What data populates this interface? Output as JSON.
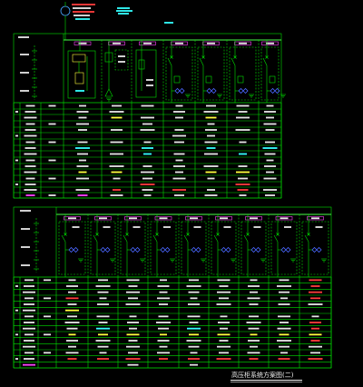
{
  "drawing": {
    "title": "高压柜系统方案图(二)"
  },
  "colors": {
    "background": "#000000",
    "frame": "#00e000",
    "busbar": "#49ff49",
    "label_box": "#ff40ff",
    "current_transformer": "#4a66ff",
    "symbol": "#4aa8ff",
    "text_white": "#e6e6e6",
    "text_yellow": "#ffff3c",
    "text_cyan": "#33ffff",
    "text_red": "#ff3c3c"
  }
}
